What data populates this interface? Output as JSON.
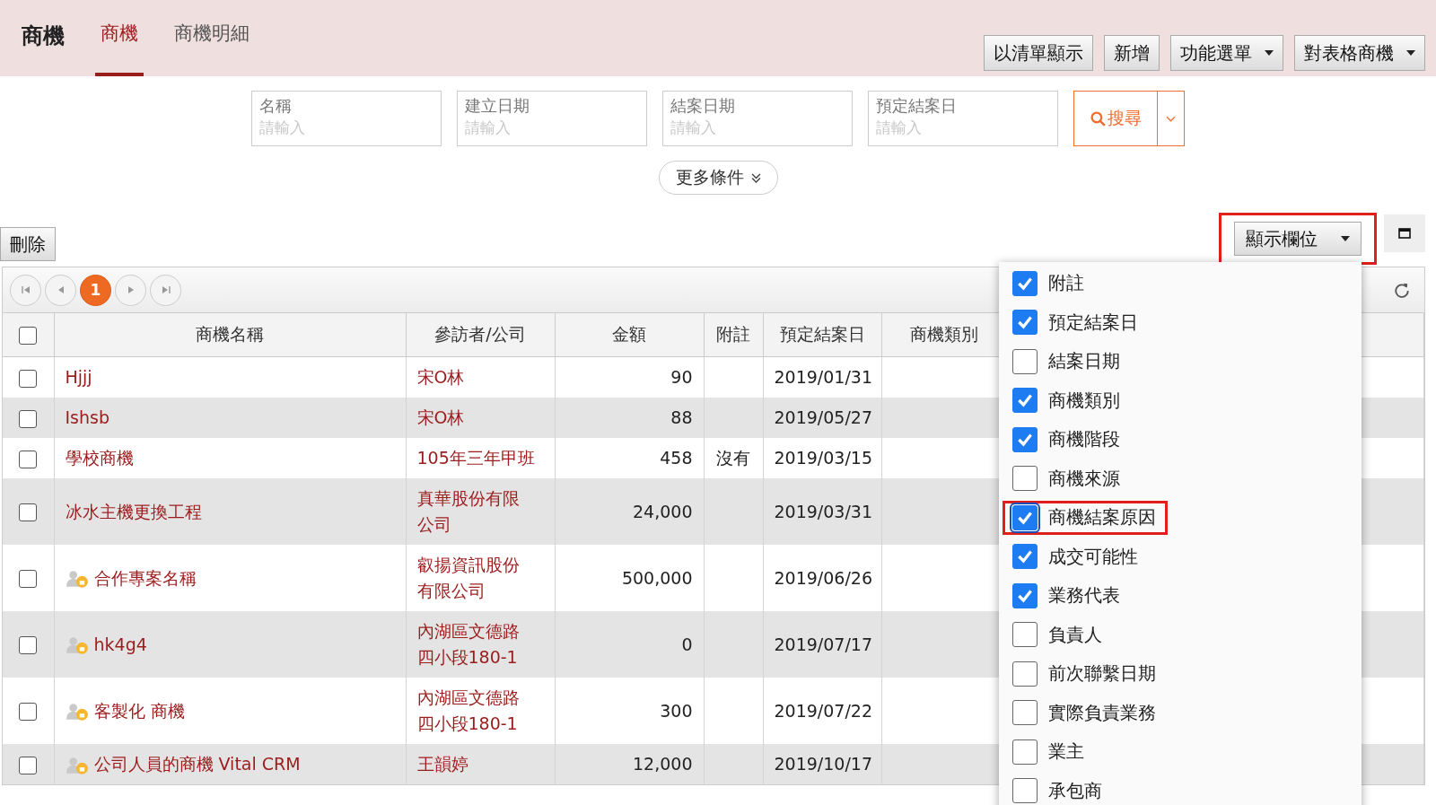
{
  "header": {
    "title": "商機",
    "tabs": [
      {
        "label": "商機",
        "selected": true
      },
      {
        "label": "商機明細",
        "selected": false
      }
    ],
    "buttons": [
      {
        "label": "以清單顯示",
        "dropdown": false
      },
      {
        "label": "新增",
        "dropdown": false
      },
      {
        "label": "功能選單",
        "dropdown": true
      },
      {
        "label": "對表格商機",
        "dropdown": true
      }
    ]
  },
  "filters": [
    {
      "label": "名稱",
      "placeholder": "請輸入"
    },
    {
      "label": "建立日期",
      "placeholder": "請輸入"
    },
    {
      "label": "結案日期",
      "placeholder": "請輸入"
    },
    {
      "label": "預定結案日",
      "placeholder": "請輸入"
    }
  ],
  "search_button": "搜尋",
  "more_conditions": "更多條件",
  "delete_button": "刪除",
  "display_columns_button": {
    "label": "顯示欄位",
    "highlighted": true
  },
  "pager": {
    "pages": [
      {
        "label": "1",
        "selected": true
      }
    ]
  },
  "table": {
    "select_all_checked": false,
    "columns": [
      "商機名稱",
      "參訪者/公司",
      "金額",
      "附註",
      "預定結案日",
      "商機類別"
    ],
    "rows": [
      {
        "checked": false,
        "shared": false,
        "name": "Hjjj",
        "visitor": [
          "宋O林"
        ],
        "amount": "90",
        "note": "",
        "date": "2019/01/31"
      },
      {
        "checked": false,
        "shared": false,
        "name": "Ishsb",
        "visitor": [
          "宋O林"
        ],
        "amount": "88",
        "note": "",
        "date": "2019/05/27"
      },
      {
        "checked": false,
        "shared": false,
        "name": "學校商機",
        "visitor": [
          "105年三年甲班"
        ],
        "amount": "458",
        "note": "沒有",
        "date": "2019/03/15"
      },
      {
        "checked": false,
        "shared": false,
        "name": "冰水主機更換工程",
        "visitor": [
          "真華股份有限",
          "公司"
        ],
        "amount": "24,000",
        "note": "",
        "date": "2019/03/31"
      },
      {
        "checked": false,
        "shared": true,
        "name": "合作專案名稱",
        "visitor": [
          "叡揚資訊股份",
          "有限公司"
        ],
        "amount": "500,000",
        "note": "",
        "date": "2019/06/26"
      },
      {
        "checked": false,
        "shared": true,
        "name": "hk4g4",
        "visitor": [
          "內湖區文德路",
          "四小段180-1"
        ],
        "amount": "0",
        "note": "",
        "date": "2019/07/17"
      },
      {
        "checked": false,
        "shared": true,
        "name": "客製化 商機",
        "visitor": [
          "內湖區文德路",
          "四小段180-1"
        ],
        "amount": "300",
        "note": "",
        "date": "2019/07/22"
      },
      {
        "checked": false,
        "shared": true,
        "name": "公司人員的商機 Vital CRM",
        "visitor": [
          "王韻婷"
        ],
        "amount": "12,000",
        "note": "",
        "date": "2019/10/17"
      }
    ]
  },
  "column_menu": [
    {
      "label": "附註",
      "checked": true,
      "highlighted": false
    },
    {
      "label": "預定結案日",
      "checked": true,
      "highlighted": false
    },
    {
      "label": "結案日期",
      "checked": false,
      "highlighted": false
    },
    {
      "label": "商機類別",
      "checked": true,
      "highlighted": false
    },
    {
      "label": "商機階段",
      "checked": true,
      "highlighted": false
    },
    {
      "label": "商機來源",
      "checked": false,
      "highlighted": false
    },
    {
      "label": "商機結案原因",
      "checked": true,
      "highlighted": true
    },
    {
      "label": "成交可能性",
      "checked": true,
      "highlighted": false
    },
    {
      "label": "業務代表",
      "checked": true,
      "highlighted": false
    },
    {
      "label": "負責人",
      "checked": false,
      "highlighted": false
    },
    {
      "label": "前次聯繫日期",
      "checked": false,
      "highlighted": false
    },
    {
      "label": "實際負責業務",
      "checked": false,
      "highlighted": false
    },
    {
      "label": "業主",
      "checked": false,
      "highlighted": false
    },
    {
      "label": "承包商",
      "checked": false,
      "highlighted": false
    }
  ]
}
